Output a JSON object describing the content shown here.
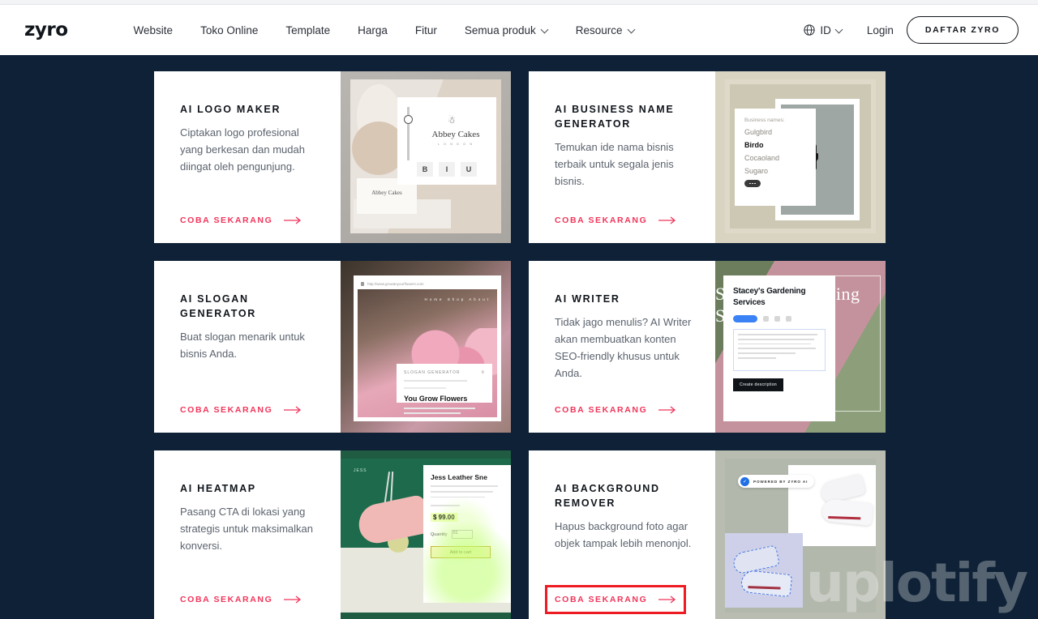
{
  "header": {
    "logo": "zyro",
    "nav": [
      {
        "label": "Website",
        "has_dropdown": false
      },
      {
        "label": "Toko Online",
        "has_dropdown": false
      },
      {
        "label": "Template",
        "has_dropdown": false
      },
      {
        "label": "Harga",
        "has_dropdown": false
      },
      {
        "label": "Fitur",
        "has_dropdown": false
      },
      {
        "label": "Semua produk",
        "has_dropdown": true
      },
      {
        "label": "Resource",
        "has_dropdown": true
      }
    ],
    "language": "ID",
    "login_label": "Login",
    "signup_label": "DAFTAR ZYRO"
  },
  "colors": {
    "page_background": "#0e2136",
    "card_background": "#ffffff",
    "accent_pink": "#f1355a",
    "highlight_red": "#ee1c22",
    "title_dark": "#11161c",
    "body_gray": "#5c636e"
  },
  "cards": [
    {
      "title": "AI LOGO MAKER",
      "description": "Ciptakan logo profesional yang berkesan dan mudah diingat oleh pengunjung.",
      "cta": "COBA SEKARANG",
      "highlighted": false,
      "image": {
        "name": "ai-logo-maker-preview",
        "logo_name": "Abbey Cakes",
        "logo_sub": "L O N D O N",
        "tools": [
          "B",
          "I",
          "U"
        ]
      }
    },
    {
      "title": "AI BUSINESS NAME GENERATOR",
      "description": "Temukan ide nama bisnis terbaik untuk segala jenis bisnis.",
      "cta": "COBA SEKARANG",
      "highlighted": false,
      "image": {
        "name": "ai-business-name-generator-preview",
        "list_heading": "Business names:",
        "names": [
          "Gulgbird",
          "Birdo",
          "Cocaoland",
          "Sugaro"
        ],
        "selected_name": "Birdo"
      }
    },
    {
      "title": "AI SLOGAN GENERATOR",
      "description": "Buat slogan menarik untuk bisnis Anda.",
      "cta": "COBA SEKARANG",
      "highlighted": false,
      "image": {
        "name": "ai-slogan-generator-preview",
        "slogan": "You Grow Flowers",
        "panel_heading": "SLOGAN GENERATOR"
      }
    },
    {
      "title": "AI WRITER",
      "description": "Tidak jago menulis? AI Writer akan membuatkan konten SEO-friendly khusus untuk Anda.",
      "cta": "COBA SEKARANG",
      "highlighted": false,
      "image": {
        "name": "ai-writer-preview",
        "business_name": "Stacey's Gardening Services",
        "overlay_text": "Stacey's Gardening Services",
        "button": "Create description"
      }
    },
    {
      "title": "AI HEATMAP",
      "description": "Pasang CTA di lokasi yang strategis untuk maksimalkan konversi.",
      "cta": "COBA SEKARANG",
      "highlighted": false,
      "image": {
        "name": "ai-heatmap-preview",
        "brand": "JESS",
        "product": "Jess Leather Sne",
        "price": "$ 99.00",
        "quantity_label": "Quantity",
        "quantity_value": "01",
        "button": "Add to cart"
      }
    },
    {
      "title": "AI BACKGROUND REMOVER",
      "description": "Hapus background foto agar objek tampak lebih menonjol.",
      "cta": "COBA SEKARANG",
      "highlighted": true,
      "image": {
        "name": "ai-background-remover-preview",
        "badge": "POWERED BY ZYRO AI"
      }
    }
  ],
  "watermark": "uplotify"
}
